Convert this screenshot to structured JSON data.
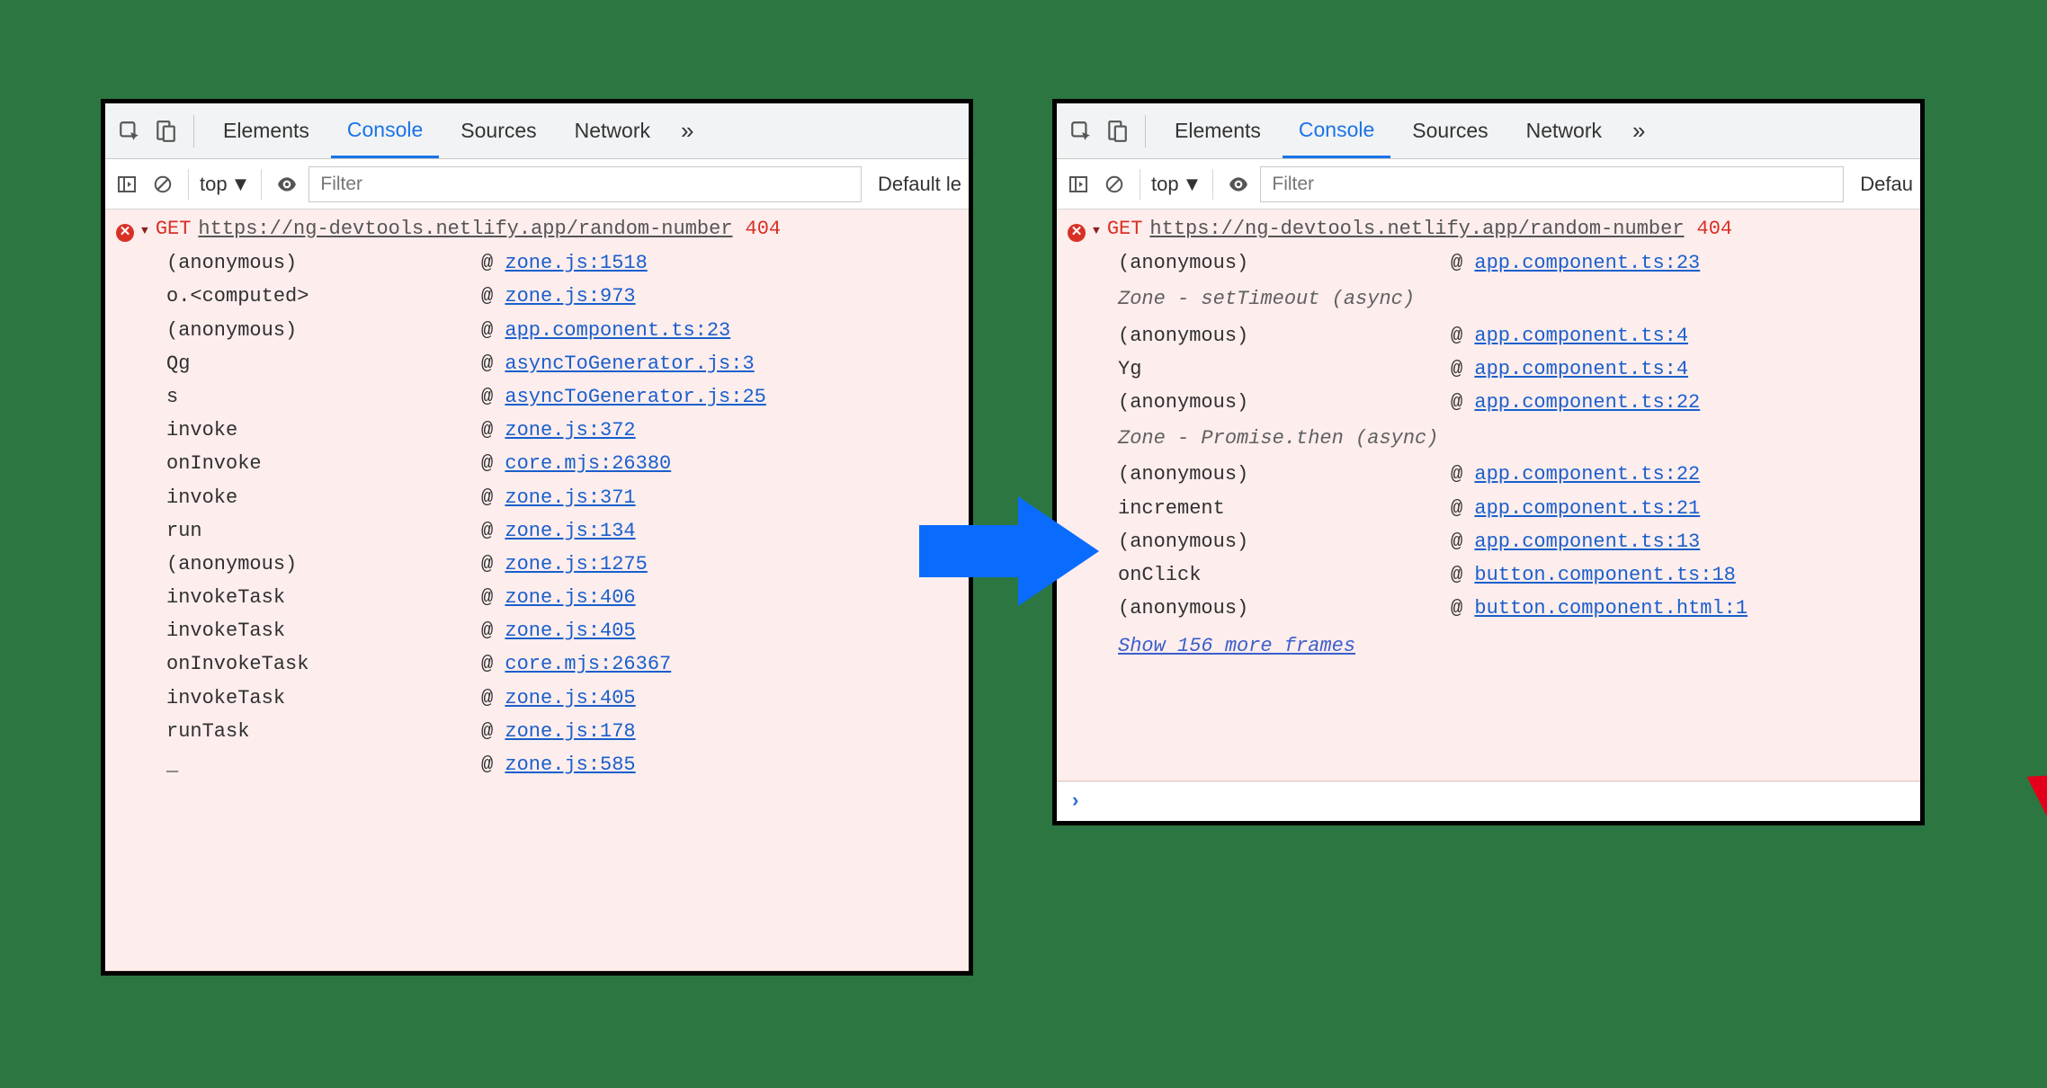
{
  "tabs": {
    "elements": "Elements",
    "console": "Console",
    "sources": "Sources",
    "network": "Network"
  },
  "toolbar": {
    "context": "top",
    "filter_placeholder": "Filter",
    "levels_left": "Default le",
    "levels_right": "Defau"
  },
  "left": {
    "method": "GET",
    "url": "https://ng-devtools.netlify.app/random-number",
    "status": "404",
    "frames": [
      {
        "fn": "(anonymous)",
        "src": "zone.js:1518"
      },
      {
        "fn": "o.<computed>",
        "src": "zone.js:973"
      },
      {
        "fn": "(anonymous)",
        "src": "app.component.ts:23"
      },
      {
        "fn": "Qg",
        "src": "asyncToGenerator.js:3"
      },
      {
        "fn": "s",
        "src": "asyncToGenerator.js:25"
      },
      {
        "fn": "invoke",
        "src": "zone.js:372"
      },
      {
        "fn": "onInvoke",
        "src": "core.mjs:26380"
      },
      {
        "fn": "invoke",
        "src": "zone.js:371"
      },
      {
        "fn": "run",
        "src": "zone.js:134"
      },
      {
        "fn": "(anonymous)",
        "src": "zone.js:1275"
      },
      {
        "fn": "invokeTask",
        "src": "zone.js:406"
      },
      {
        "fn": "invokeTask",
        "src": "zone.js:405"
      },
      {
        "fn": "onInvokeTask",
        "src": "core.mjs:26367"
      },
      {
        "fn": "invokeTask",
        "src": "zone.js:405"
      },
      {
        "fn": "runTask",
        "src": "zone.js:178"
      },
      {
        "fn": "_",
        "src": "zone.js:585"
      }
    ]
  },
  "right": {
    "method": "GET",
    "url": "https://ng-devtools.netlify.app/random-number",
    "status": "404",
    "group0": [
      {
        "fn": "(anonymous)",
        "src": "app.component.ts:23"
      }
    ],
    "async1_label": "Zone - setTimeout (async)",
    "group1": [
      {
        "fn": "(anonymous)",
        "src": "app.component.ts:4"
      },
      {
        "fn": "Yg",
        "src": "app.component.ts:4"
      },
      {
        "fn": "(anonymous)",
        "src": "app.component.ts:22"
      }
    ],
    "async2_label": "Zone - Promise.then (async)",
    "group2": [
      {
        "fn": "(anonymous)",
        "src": "app.component.ts:22"
      },
      {
        "fn": "increment",
        "src": "app.component.ts:21"
      },
      {
        "fn": "(anonymous)",
        "src": "app.component.ts:13"
      },
      {
        "fn": "onClick",
        "src": "button.component.ts:18"
      },
      {
        "fn": "(anonymous)",
        "src": "button.component.html:1"
      }
    ],
    "show_more": "Show 156 more frames"
  }
}
